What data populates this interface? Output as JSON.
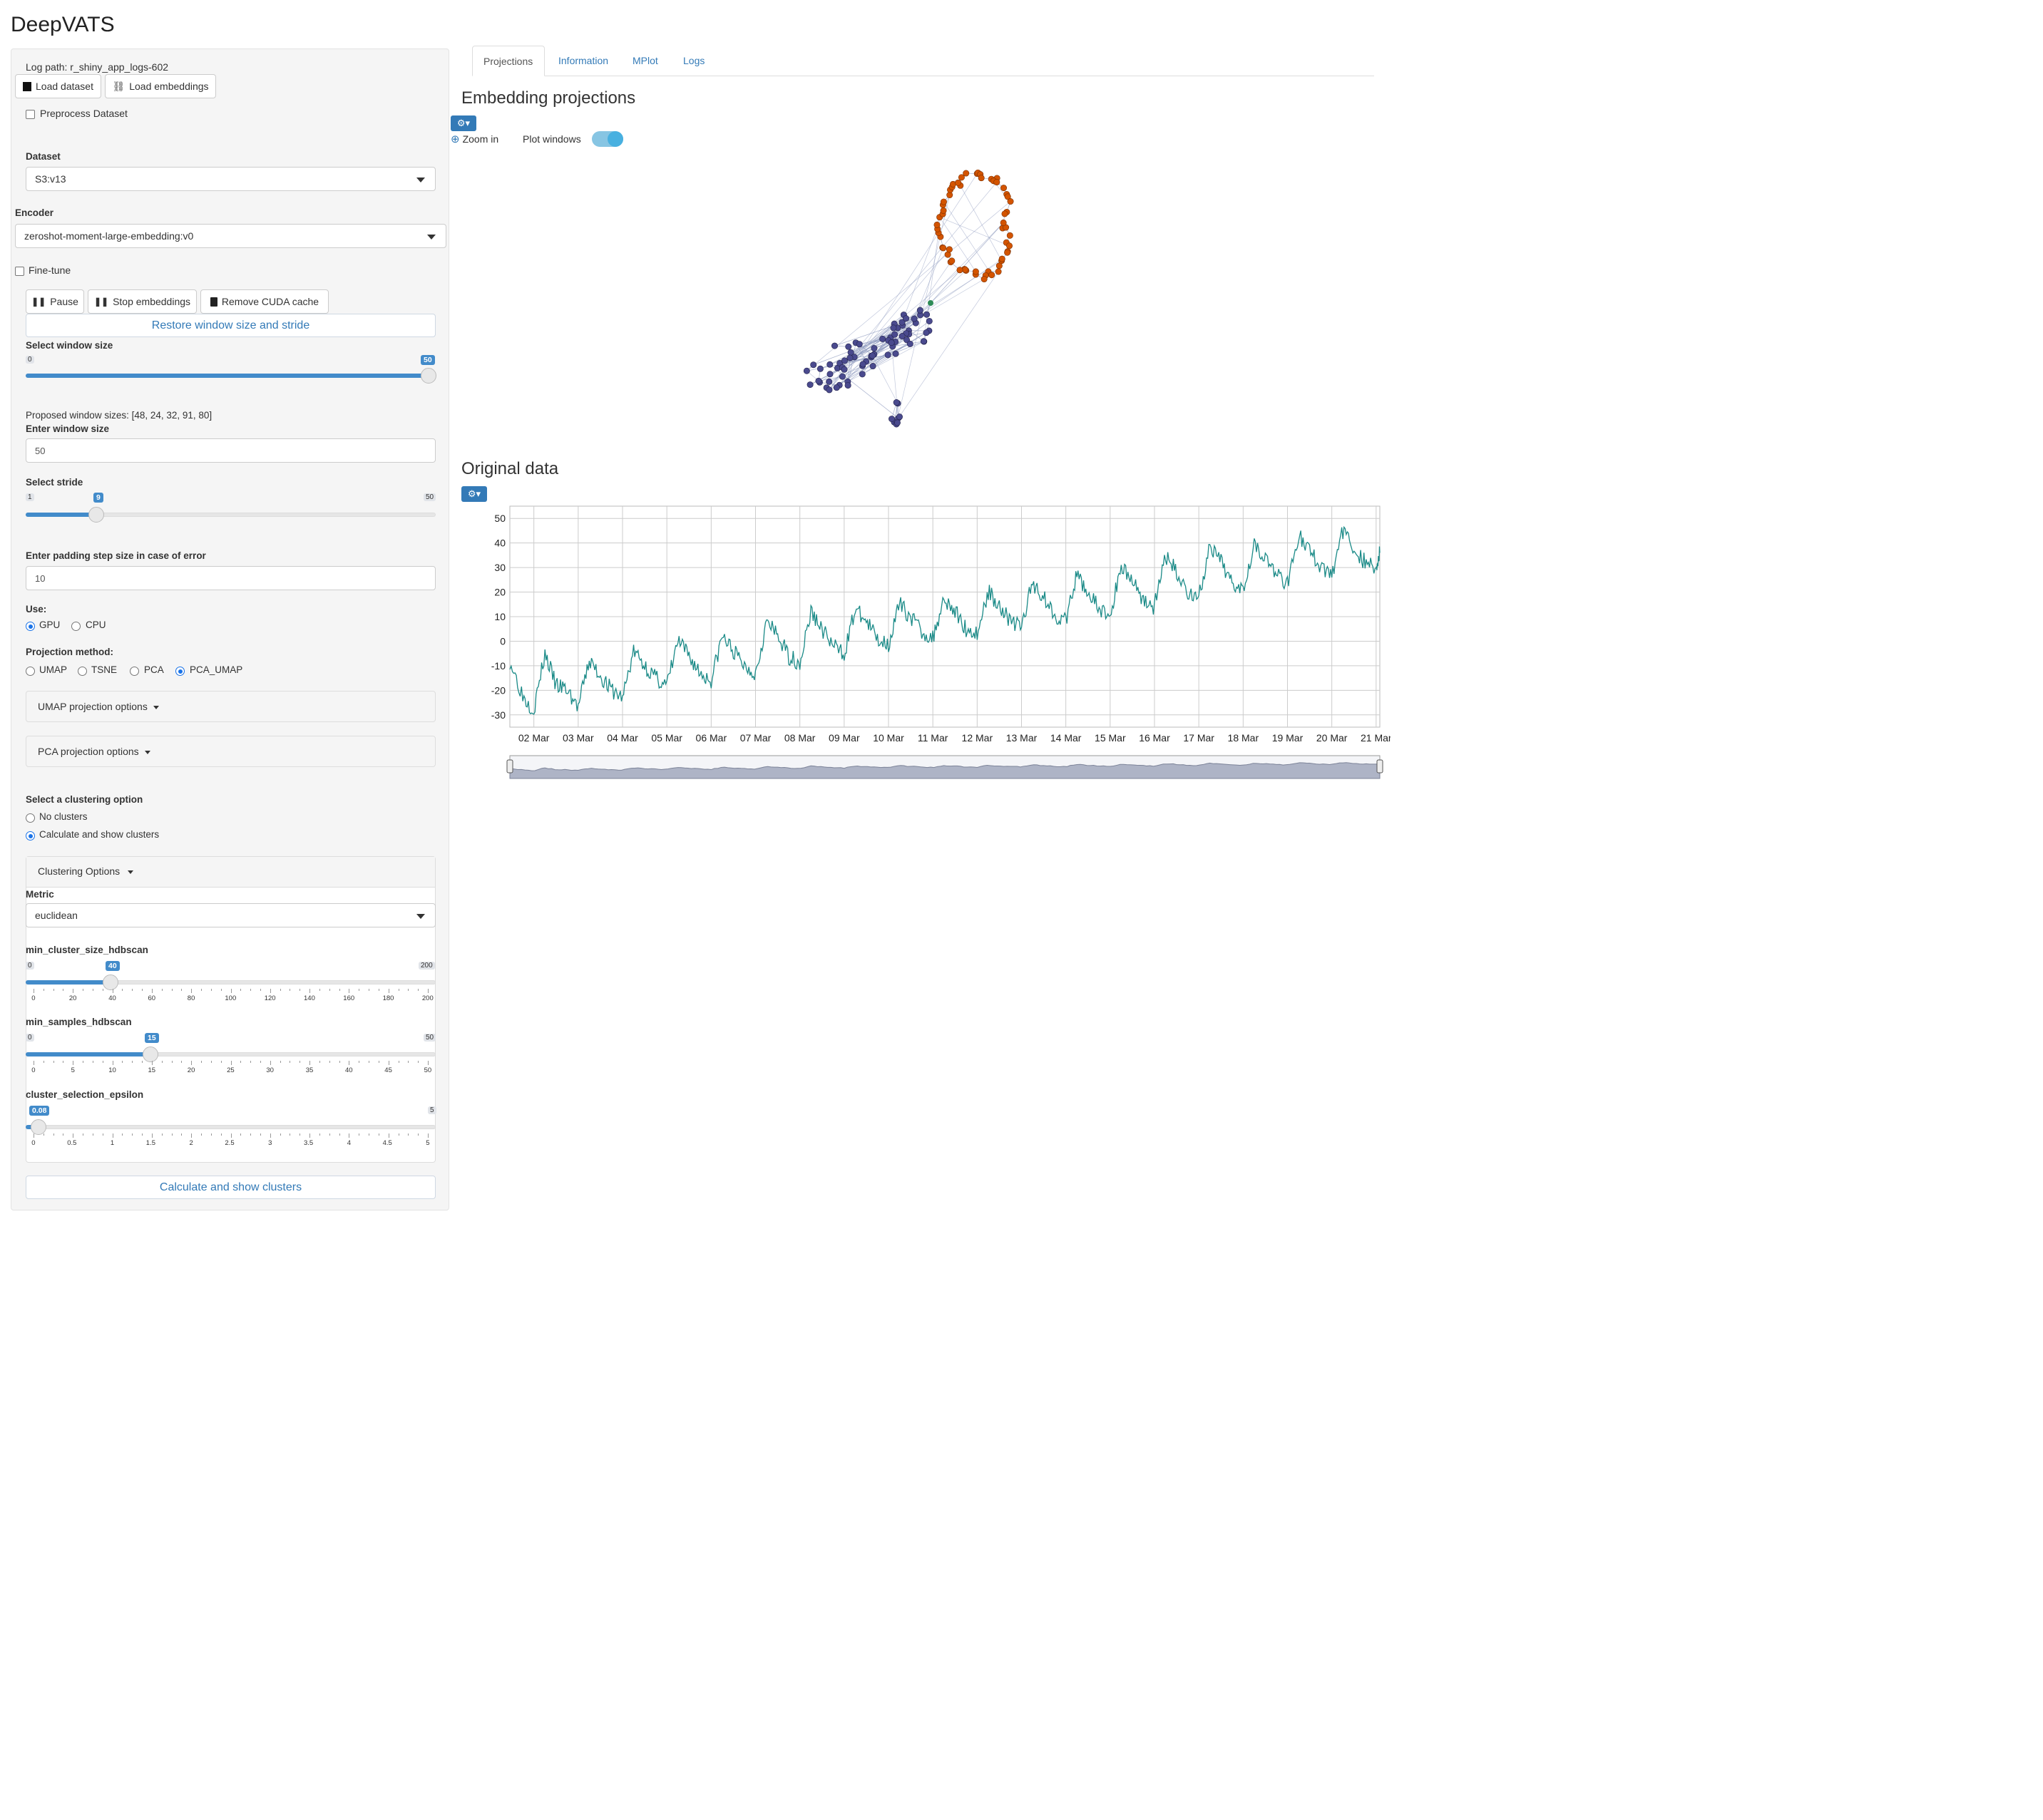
{
  "app": {
    "title": "DeepVATS"
  },
  "sidebar": {
    "log_path": "Log path: r_shiny_app_logs-602",
    "load_dataset": "Load dataset",
    "load_embeddings": "Load embeddings",
    "preprocess_label": "Preprocess Dataset",
    "dataset_label": "Dataset",
    "dataset_value": "S3:v13",
    "encoder_label": "Encoder",
    "encoder_value": "zeroshot-moment-large-embedding:v0",
    "finetune_label": "Fine-tune",
    "pause": "Pause",
    "stop_embeddings": "Stop embeddings",
    "remove_cuda": "Remove CUDA cache",
    "restore": "Restore window size and stride",
    "window_size": {
      "label": "Select window size",
      "min": "0",
      "max": "50",
      "value": "50",
      "fraction": 1.0
    },
    "proposed": "Proposed window sizes: [48, 24, 32, 91, 80]",
    "enter_window_label": "Enter window size",
    "enter_window_value": "50",
    "stride": {
      "label": "Select stride",
      "min": "1",
      "max": "50",
      "value": "9",
      "fraction": 0.1633
    },
    "padding_label": "Enter padding step size in case of error",
    "padding_value": "10",
    "use_label": "Use:",
    "use_options": [
      "GPU",
      "CPU"
    ],
    "use_selected": "GPU",
    "projection_label": "Projection method:",
    "projection_options": [
      "UMAP",
      "TSNE",
      "PCA",
      "PCA_UMAP"
    ],
    "projection_selected": "PCA_UMAP",
    "umap_options": "UMAP projection options",
    "pca_options": "PCA projection options",
    "cluster_label": "Select a clustering option",
    "cluster_options": [
      "No clusters",
      "Calculate and show clusters"
    ],
    "cluster_selected": "Calculate and show clusters",
    "clustering_options": "Clustering Options",
    "metric_label": "Metric",
    "metric_value": "euclidean",
    "min_cluster": {
      "label": "min_cluster_size_hdbscan",
      "min": "0",
      "max": "200",
      "value": "40",
      "fraction": 0.2,
      "ticks": [
        "0",
        "20",
        "40",
        "60",
        "80",
        "100",
        "120",
        "140",
        "160",
        "180",
        "200"
      ]
    },
    "min_samples": {
      "label": "min_samples_hdbscan",
      "min": "0",
      "max": "50",
      "value": "15",
      "fraction": 0.3,
      "ticks": [
        "0",
        "5",
        "10",
        "15",
        "20",
        "25",
        "30",
        "35",
        "40",
        "45",
        "50"
      ]
    },
    "epsilon": {
      "label": "cluster_selection_epsilon",
      "min": "0",
      "max": "5",
      "value": "0.08",
      "fraction": 0.016,
      "ticks": [
        "0",
        "0.5",
        "1",
        "1.5",
        "2",
        "2.5",
        "3",
        "3.5",
        "4",
        "4.5",
        "5"
      ]
    },
    "calc_button": "Calculate and show clusters"
  },
  "tabs": [
    "Projections",
    "Information",
    "MPlot",
    "Logs"
  ],
  "active_tab": "Projections",
  "projections": {
    "title": "Embedding projections",
    "zoom_in": "Zoom in",
    "plot_windows": "Plot windows",
    "plot_windows_on": true,
    "cluster_colors": {
      "orange": "#d35400",
      "purple": "#4a4a8e",
      "green": "#2e8b57",
      "edges": "#8f9bbf"
    }
  },
  "original": {
    "title": "Original data",
    "line_color": "#1a8a87"
  },
  "chart_data": {
    "type": "line",
    "title": "",
    "xlabel": "",
    "ylabel": "",
    "x_tick_labels": [
      "02 Mar",
      "03 Mar",
      "04 Mar",
      "05 Mar",
      "06 Mar",
      "07 Mar",
      "08 Mar",
      "09 Mar",
      "10 Mar",
      "11 Mar",
      "12 Mar",
      "13 Mar",
      "14 Mar",
      "15 Mar",
      "16 Mar",
      "17 Mar",
      "18 Mar",
      "19 Mar",
      "20 Mar",
      "21 Mar"
    ],
    "y_ticks": [
      50,
      40,
      30,
      20,
      10,
      0,
      -10,
      -20,
      -30
    ],
    "ylim": [
      -35,
      55
    ],
    "xlim": [
      "01 Mar 11:00",
      "21 Mar 02:00"
    ],
    "grid": true,
    "series": [
      {
        "x_day_fraction_note": "",
        "x": [
          "01 Mar 11:00",
          "01 Mar 18:00",
          "02 Mar 00:00",
          "02 Mar 06:00",
          "02 Mar 12:00",
          "02 Mar 18:00",
          "03 Mar 00:00",
          "03 Mar 06:00",
          "03 Mar 12:00",
          "03 Mar 18:00",
          "04 Mar 00:00",
          "04 Mar 06:00",
          "04 Mar 12:00",
          "04 Mar 18:00",
          "05 Mar 00:00",
          "05 Mar 06:00",
          "05 Mar 12:00",
          "05 Mar 18:00",
          "06 Mar 00:00",
          "06 Mar 06:00",
          "06 Mar 12:00",
          "06 Mar 18:00",
          "07 Mar 00:00",
          "07 Mar 06:00",
          "07 Mar 12:00",
          "07 Mar 18:00",
          "08 Mar 00:00",
          "08 Mar 06:00",
          "08 Mar 12:00",
          "08 Mar 18:00",
          "09 Mar 00:00",
          "09 Mar 06:00",
          "09 Mar 12:00",
          "09 Mar 18:00",
          "10 Mar 00:00",
          "10 Mar 06:00",
          "10 Mar 12:00",
          "10 Mar 18:00",
          "11 Mar 00:00",
          "11 Mar 06:00",
          "11 Mar 12:00",
          "11 Mar 18:00",
          "12 Mar 00:00",
          "12 Mar 06:00",
          "12 Mar 12:00",
          "12 Mar 18:00",
          "13 Mar 00:00",
          "13 Mar 06:00",
          "13 Mar 12:00",
          "13 Mar 18:00",
          "14 Mar 00:00",
          "14 Mar 06:00",
          "14 Mar 12:00",
          "14 Mar 18:00",
          "15 Mar 00:00",
          "15 Mar 06:00",
          "15 Mar 12:00",
          "15 Mar 18:00",
          "16 Mar 00:00",
          "16 Mar 06:00",
          "16 Mar 12:00",
          "16 Mar 18:00",
          "17 Mar 00:00",
          "17 Mar 06:00",
          "17 Mar 12:00",
          "17 Mar 18:00",
          "18 Mar 00:00",
          "18 Mar 06:00",
          "18 Mar 12:00",
          "18 Mar 18:00",
          "19 Mar 00:00",
          "19 Mar 06:00",
          "19 Mar 12:00",
          "19 Mar 18:00",
          "20 Mar 00:00",
          "20 Mar 06:00",
          "20 Mar 12:00",
          "20 Mar 18:00",
          "21 Mar 00:00",
          "21 Mar 02:00"
        ],
        "y": [
          -8,
          -22,
          -28,
          -5,
          -18,
          -20,
          -27,
          -8,
          -14,
          -20,
          -23,
          -4,
          -10,
          -15,
          -18,
          0,
          -6,
          -13,
          -16,
          2,
          -4,
          -10,
          -13,
          8,
          2,
          -6,
          -9,
          12,
          5,
          -2,
          -5,
          13,
          8,
          1,
          -1,
          15,
          10,
          4,
          1,
          18,
          12,
          5,
          3,
          20,
          15,
          8,
          6,
          24,
          18,
          11,
          8,
          27,
          20,
          13,
          10,
          31,
          25,
          17,
          14,
          35,
          28,
          20,
          18,
          38,
          32,
          24,
          22,
          40,
          34,
          27,
          24,
          43,
          37,
          30,
          27,
          45,
          38,
          32,
          30,
          36
        ]
      }
    ]
  }
}
